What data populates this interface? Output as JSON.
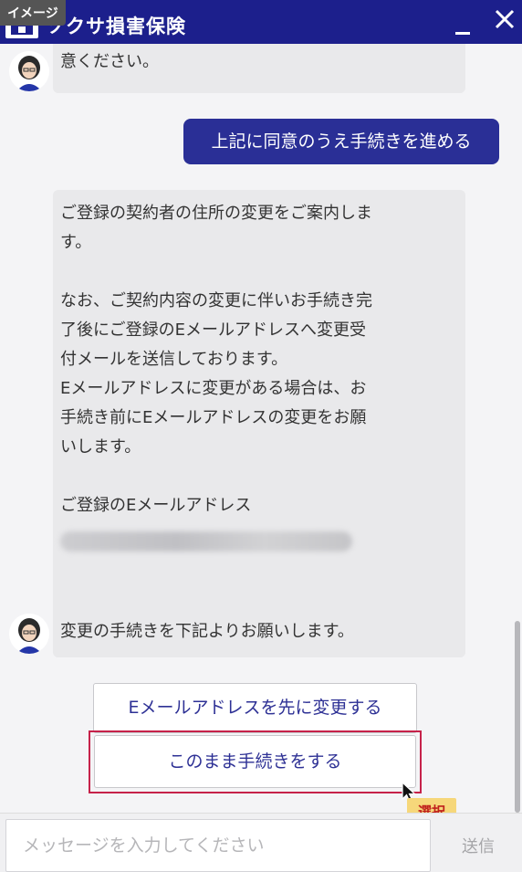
{
  "badge": {
    "label": "イメージ"
  },
  "header": {
    "title": "ソクサ損害保険",
    "minimize_icon": "minimize-icon",
    "close_icon": "close-icon"
  },
  "chat": {
    "messages": [
      {
        "role": "bot",
        "lines": [
          "意ください。"
        ]
      },
      {
        "role": "user",
        "text": "上記に同意のうえ手続きを進める"
      },
      {
        "role": "bot",
        "lines": [
          "ご登録の契約者の住所の変更をご案内しま",
          "す。",
          "",
          "なお、ご契約内容の変更に伴いお手続き完",
          "了後にご登録のEメールアドレスへ変更受",
          "付メールを送信しております。",
          "Eメールアドレスに変更がある場合は、お",
          "手続き前にEメールアドレスの変更をお願",
          "いします。",
          "",
          "ご登録のEメールアドレス"
        ]
      },
      {
        "role": "bot",
        "lines": [
          "変更の手続きを下記よりお願いします。"
        ]
      }
    ],
    "options": [
      {
        "label": "Eメールアドレスを先に変更する"
      },
      {
        "label": "このまま手続きをする"
      }
    ],
    "annotation": {
      "label": "選択"
    }
  },
  "input": {
    "placeholder": "メッセージを入力してください",
    "send_label": "送信"
  },
  "colors": {
    "header_bg": "#1c1f8c",
    "user_bubble": "#2a2f96",
    "highlight_border": "#c6224a",
    "annotation_bg": "#f6d77a"
  }
}
